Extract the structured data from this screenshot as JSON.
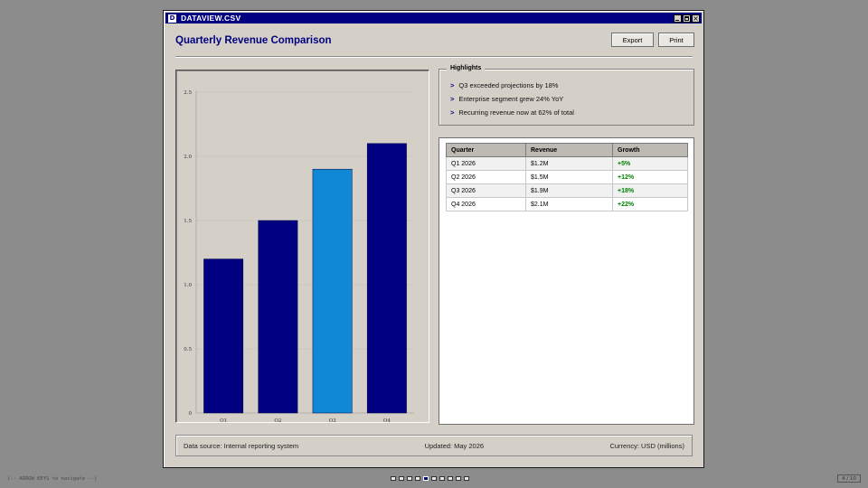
{
  "window": {
    "title": "DATAVIEW.CSV",
    "icon_letter": "D"
  },
  "page_title": "Quarterly Revenue Comparison",
  "toolbar": {
    "export_label": "Export",
    "print_label": "Print"
  },
  "highlights": {
    "legend": "Highlights",
    "arrow": ">",
    "items": [
      "Q3 exceeded projections by 18%",
      "Enterprise segment grew 24% YoY",
      "Recurring revenue now at 62% of total"
    ]
  },
  "table": {
    "headers": [
      "Quarter",
      "Revenue",
      "Growth"
    ],
    "rows": [
      [
        "Q1 2026",
        "$1.2M",
        "+5%"
      ],
      [
        "Q2 2026",
        "$1.5M",
        "+12%"
      ],
      [
        "Q3 2026",
        "$1.9M",
        "+18%"
      ],
      [
        "Q4 2026",
        "$2.1M",
        "+22%"
      ]
    ]
  },
  "status": {
    "source": "Data source: Internal reporting system",
    "updated": "Updated: May 2026",
    "currency": "Currency: USD (millions)"
  },
  "footer": {
    "hint": "(-- ARROW KEYS to navigate --)",
    "page_count": "4 / 10",
    "pager_dots": 10,
    "active_dot": 4
  },
  "colors": {
    "accent": "#000080",
    "bar": "#000080",
    "bar_highlight": "#1188d4",
    "growth_positive": "#008000"
  },
  "chart_data": {
    "type": "bar",
    "categories": [
      "Q1",
      "Q2",
      "Q3",
      "Q4"
    ],
    "values": [
      1.2,
      1.5,
      1.9,
      2.1
    ],
    "yticks": [
      "0",
      "0.5",
      "1.0",
      "1.5",
      "2.0",
      "2.5"
    ],
    "ylim": [
      0,
      2.5
    ],
    "highlight_index": 2,
    "grid": true
  }
}
